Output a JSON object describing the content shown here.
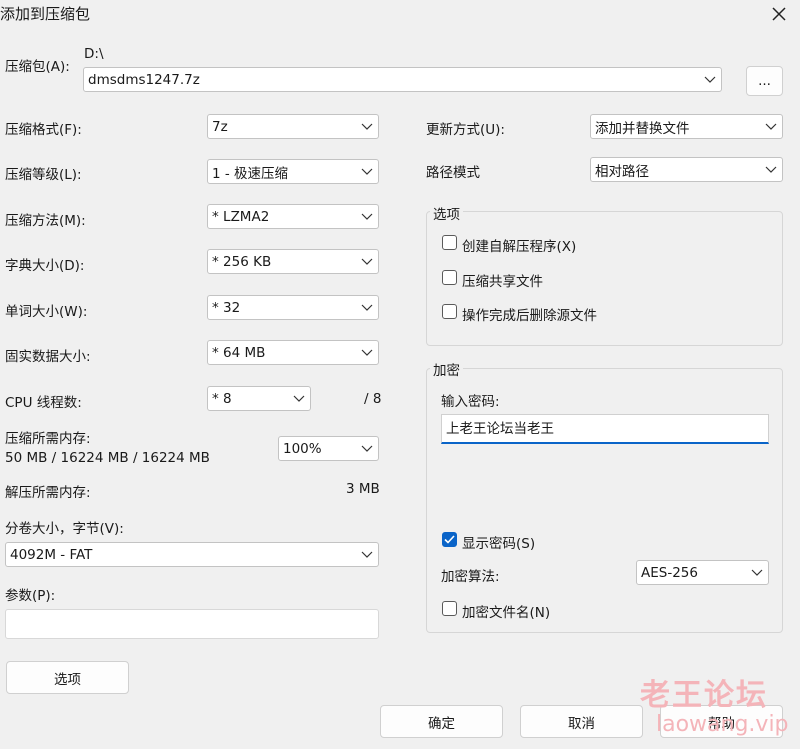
{
  "window": {
    "title": "添加到压缩包"
  },
  "archive": {
    "label": "压缩包(A):",
    "path": "D:\\",
    "value": "dmsdms1247.7z",
    "browse": "..."
  },
  "left": {
    "format": {
      "label": "压缩格式(F):",
      "value": "7z"
    },
    "level": {
      "label": "压缩等级(L):",
      "value": "1 - 极速压缩"
    },
    "method": {
      "label": "压缩方法(M):",
      "value": "*  LZMA2"
    },
    "dict": {
      "label": "字典大小(D):",
      "value": "*  256 KB"
    },
    "word": {
      "label": "单词大小(W):",
      "value": "*  32"
    },
    "solid": {
      "label": "固实数据大小:",
      "value": "*  64 MB"
    },
    "cpu": {
      "label": "CPU 线程数:",
      "value": "*  8",
      "max": "/ 8"
    },
    "mem": {
      "label": "压缩所需内存:",
      "detail": "50 MB / 16224 MB / 16224 MB",
      "value": "100%"
    },
    "decompress": {
      "label": "解压所需内存:",
      "value": "3 MB"
    },
    "split": {
      "label": "分卷大小，字节(V):",
      "value": "4092M - FAT"
    },
    "params": {
      "label": "参数(P):",
      "value": ""
    },
    "options_button": "选项"
  },
  "right": {
    "update": {
      "label": "更新方式(U):",
      "value": "添加并替换文件"
    },
    "path_mode": {
      "label": "路径模式",
      "value": "相对路径"
    },
    "options": {
      "title": "选项",
      "sfx": {
        "label": "创建自解压程序(X)",
        "checked": false
      },
      "shared": {
        "label": "压缩共享文件",
        "checked": false
      },
      "delete": {
        "label": "操作完成后删除源文件",
        "checked": false
      }
    },
    "encryption": {
      "title": "加密",
      "pwd_label": "输入密码:",
      "pwd_value": "上老王论坛当老王",
      "show": {
        "label": "显示密码(S)",
        "checked": true
      },
      "algo": {
        "label": "加密算法:",
        "value": "AES-256"
      },
      "names": {
        "label": "加密文件名(N)",
        "checked": false
      }
    }
  },
  "buttons": {
    "ok": "确定",
    "cancel": "取消",
    "help": "帮助"
  },
  "watermark": {
    "cn": "老王论坛",
    "url": "laowang.vip"
  },
  "colors": {
    "accent": "#0a64c8",
    "background": "#f0f0f0",
    "watermark": "#f4b4b9"
  }
}
